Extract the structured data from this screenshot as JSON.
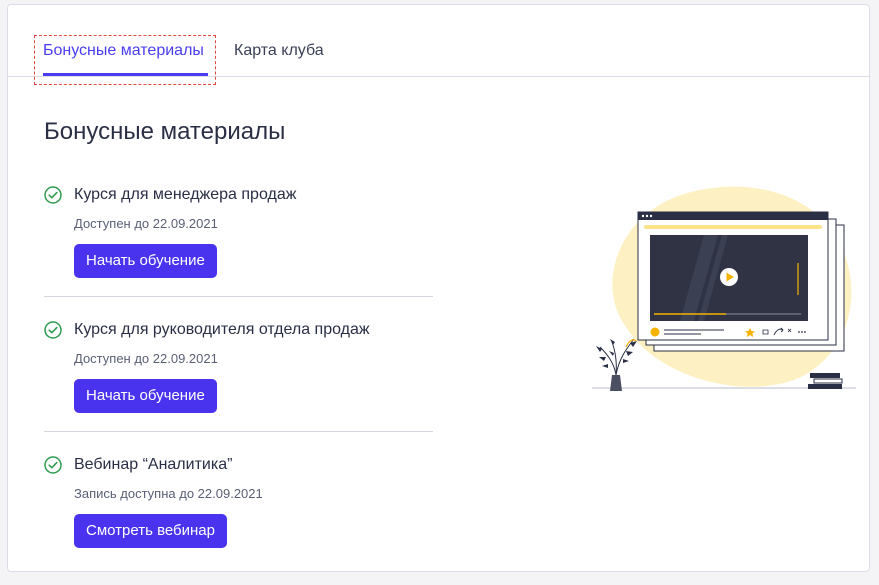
{
  "tabs": [
    {
      "label": "Бонусные материалы",
      "active": true
    },
    {
      "label": "Карта клуба",
      "active": false
    }
  ],
  "page_title": "Бонусные материалы",
  "items": [
    {
      "icon": "check-circle-icon",
      "title": "Курся для менеджера продаж",
      "availability": "Доступен до 22.09.2021",
      "button": "Начать обучение"
    },
    {
      "icon": "check-circle-icon",
      "title": "Курся для руководителя отдела продаж",
      "availability": "Доступен до 22.09.2021",
      "button": "Начать обучение"
    },
    {
      "icon": "check-circle-icon",
      "title": "Вебинар “Аналитика”",
      "availability": "Запись доступна до 22.09.2021",
      "button": "Смотреть вебинар"
    }
  ],
  "colors": {
    "accent": "#4a33ee",
    "check": "#2e9b4f",
    "blob": "#fdf1c4"
  }
}
